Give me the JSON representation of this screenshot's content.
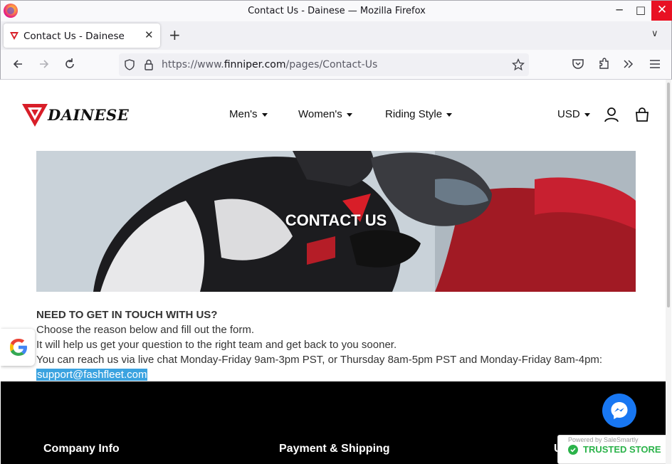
{
  "window": {
    "title": "Contact Us - Dainese — Mozilla Firefox",
    "minimize": "─",
    "maximize": "□",
    "close": "✕"
  },
  "tab": {
    "title": "Contact Us - Dainese",
    "close": "✕",
    "new_tab": "+",
    "list_all": "∨"
  },
  "url": {
    "prefix": "https://www.",
    "domain": "finniper.com",
    "path": "/pages/Contact-Us"
  },
  "site": {
    "brand": "DAINESE",
    "menu": [
      {
        "label": "Men's"
      },
      {
        "label": "Women's"
      },
      {
        "label": "Riding Style"
      }
    ],
    "currency": "USD"
  },
  "hero": {
    "title": "CONTACT US"
  },
  "contact": {
    "heading": "NEED TO GET IN TOUCH WITH US?",
    "line1": "Choose the reason below and fill out the form.",
    "line2": "It will help us get your question to the right team and get back to you sooner.",
    "line3": "You can reach us via live chat Monday-Friday 9am-3pm PST, or Thursday 8am-5pm PST and Monday-Friday 8am-4pm:",
    "email": "support@fashfleet.com"
  },
  "footer": {
    "col1": "Company Info",
    "col2": "Payment & Shipping",
    "col3": "U"
  },
  "badges": {
    "powered_by": "Powered by SaleSmartly",
    "trusted": "TRUSTED STORE"
  },
  "colors": {
    "brand_red": "#d81e28",
    "link_highlight": "#3ba3e0",
    "trusted_green": "#2bb34a",
    "messenger_blue": "#1877f2"
  }
}
